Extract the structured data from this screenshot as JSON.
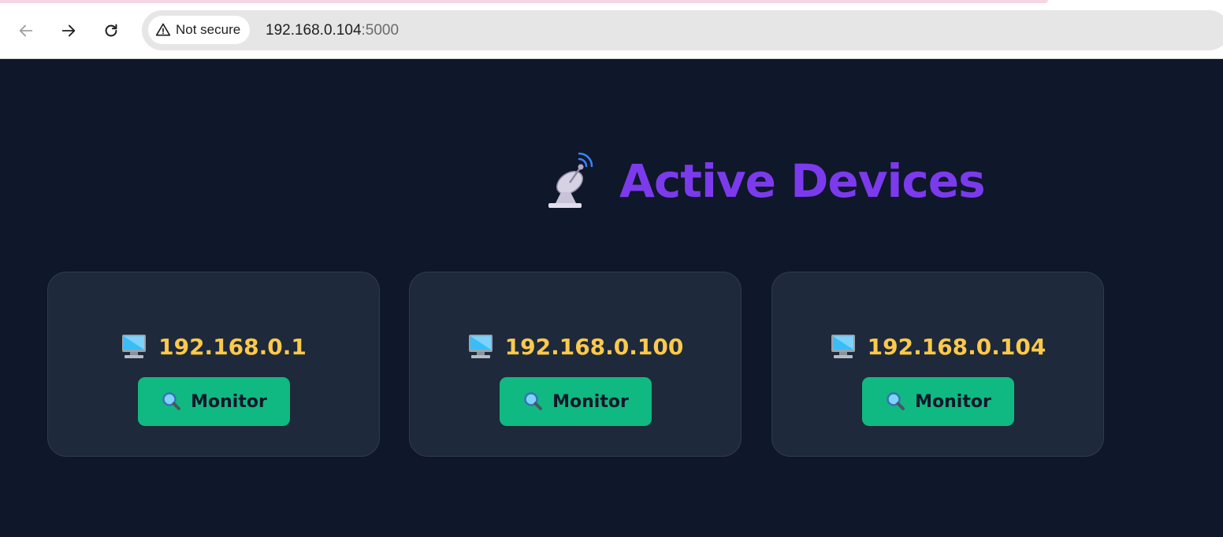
{
  "browser": {
    "security_label": "Not secure",
    "url_host": "192.168.0.104",
    "url_port": ":5000",
    "icons": {
      "back": "back-arrow-icon",
      "forward": "forward-arrow-icon",
      "reload": "reload-icon",
      "security": "warning-triangle-icon"
    }
  },
  "page": {
    "title": "Active Devices",
    "title_icon": "satellite-dish-icon",
    "colors": {
      "background": "#0f172a",
      "card": "#1e293b",
      "title": "#7c3aed",
      "ip_text": "#fcc94a",
      "button": "#10b981",
      "button_text": "#0f172a"
    }
  },
  "devices": [
    {
      "ip": "192.168.0.1",
      "icon": "desktop-computer-icon",
      "button_label": "Monitor",
      "button_icon": "magnifier-icon"
    },
    {
      "ip": "192.168.0.100",
      "icon": "desktop-computer-icon",
      "button_label": "Monitor",
      "button_icon": "magnifier-icon"
    },
    {
      "ip": "192.168.0.104",
      "icon": "desktop-computer-icon",
      "button_label": "Monitor",
      "button_icon": "magnifier-icon"
    }
  ]
}
